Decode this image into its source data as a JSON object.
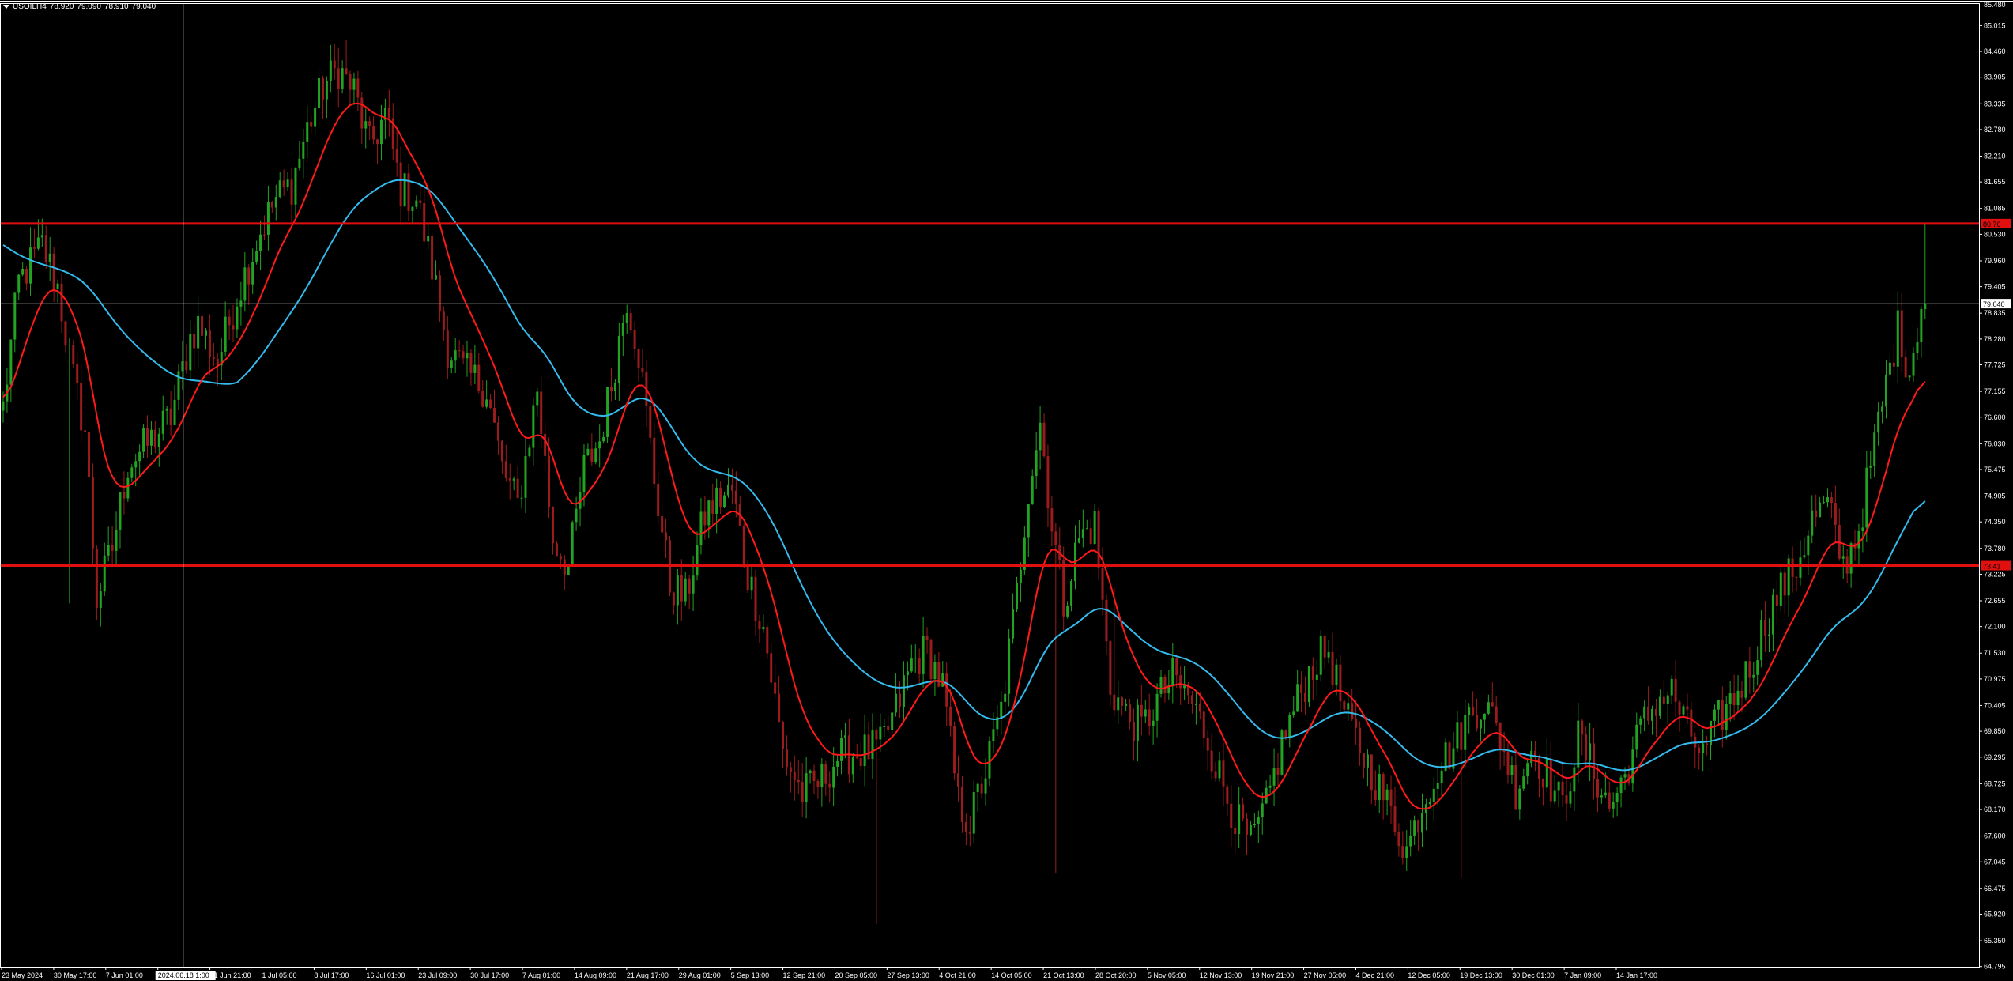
{
  "header": {
    "symbol": "USOILH4",
    "ohlc": [
      "78.920",
      "79.090",
      "78.910",
      "79.040"
    ]
  },
  "colors": {
    "background": "#000000",
    "bull_candle": "#22a322",
    "bear_candle": "#9b1c1c",
    "ma_fast": "#ff1a1a",
    "ma_slow": "#33bbee",
    "hline": "#e01010",
    "axis_text": "#ffffff",
    "grid_line": "#888888"
  },
  "chart_data": {
    "type": "candlestick",
    "ylim": [
      64.79,
      85.48
    ],
    "y_ticks": [
      "85.015",
      "84.460",
      "83.905",
      "83.335",
      "82.780",
      "82.210",
      "81.655",
      "81.085",
      "80.530",
      "79.960",
      "79.405",
      "78.835",
      "78.280",
      "77.725",
      "77.155",
      "76.600",
      "76.030",
      "75.475",
      "74.905",
      "74.350",
      "73.780",
      "73.225",
      "72.655",
      "72.100",
      "71.530",
      "70.975",
      "70.405",
      "69.850",
      "69.295",
      "68.725",
      "68.170",
      "67.600",
      "67.045",
      "66.475",
      "65.920",
      "65.350",
      "64.795"
    ],
    "top_tick": "85.480",
    "x_labels": [
      "23 May 2024",
      "30 May 17:00",
      "7 Jun 01:00",
      "2024.06.18 1:00",
      "21 Jun 21:00",
      "1 Jul 05:00",
      "8 Jul 17:00",
      "16 Jul 01:00",
      "23 Jul 09:00",
      "30 Jul 17:00",
      "7 Aug 01:00",
      "14 Aug 09:00",
      "21 Aug 17:00",
      "29 Aug 01:00",
      "5 Sep 13:00",
      "12 Sep 21:00",
      "20 Sep 05:00",
      "27 Sep 13:00",
      "4 Oct 21:00",
      "14 Oct 05:00",
      "21 Oct 13:00",
      "28 Oct 20:00",
      "5 Nov 05:00",
      "12 Nov 13:00",
      "19 Nov 21:00",
      "27 Nov 05:00",
      "4 Dec 21:00",
      "12 Dec 05:00",
      "19 Dec 13:00",
      "30 Dec 01:00",
      "7 Jan 09:00",
      "14 Jan 17:00"
    ],
    "crosshair_label_index": 3,
    "hlines": [
      {
        "price": 80.76,
        "label": "80.76"
      },
      {
        "price": 73.41,
        "label": "73.41"
      }
    ],
    "current_price": {
      "price": 79.04,
      "label": "79.040"
    },
    "price_anchors": [
      [
        0,
        76.8
      ],
      [
        4,
        79.5
      ],
      [
        10,
        80.3
      ],
      [
        14,
        79.4
      ],
      [
        18,
        77.4
      ],
      [
        21,
        76.3
      ],
      [
        24,
        72.7
      ],
      [
        28,
        73.8
      ],
      [
        32,
        75.6
      ],
      [
        38,
        76.1
      ],
      [
        43,
        76.6
      ],
      [
        48,
        78.3
      ],
      [
        50,
        78.6
      ],
      [
        55,
        77.8
      ],
      [
        60,
        79.2
      ],
      [
        66,
        80.6
      ],
      [
        70,
        81.3
      ],
      [
        74,
        81.6
      ],
      [
        78,
        82.8
      ],
      [
        82,
        83.7
      ],
      [
        86,
        84.1
      ],
      [
        90,
        83.6
      ],
      [
        94,
        82.4
      ],
      [
        98,
        83.1
      ],
      [
        102,
        81.5
      ],
      [
        106,
        81.3
      ],
      [
        110,
        79.8
      ],
      [
        114,
        78.1
      ],
      [
        118,
        77.6
      ],
      [
        124,
        77.2
      ],
      [
        128,
        75.5
      ],
      [
        132,
        74.7
      ],
      [
        137,
        77.2
      ],
      [
        141,
        74.0
      ],
      [
        145,
        73.4
      ],
      [
        149,
        75.5
      ],
      [
        153,
        76.1
      ],
      [
        156,
        77.3
      ],
      [
        160,
        79.2
      ],
      [
        163,
        78.0
      ],
      [
        167,
        75.3
      ],
      [
        171,
        73.0
      ],
      [
        175,
        72.7
      ],
      [
        180,
        74.5
      ],
      [
        183,
        74.8
      ],
      [
        187,
        75.0
      ],
      [
        191,
        73.2
      ],
      [
        195,
        72.1
      ],
      [
        200,
        69.4
      ],
      [
        205,
        68.5
      ],
      [
        210,
        68.8
      ],
      [
        214,
        69.3
      ],
      [
        220,
        69.4
      ],
      [
        225,
        69.5
      ],
      [
        229,
        70.3
      ],
      [
        233,
        71.3
      ],
      [
        237,
        71.6
      ],
      [
        241,
        70.8
      ],
      [
        245,
        68.3
      ],
      [
        248,
        67.9
      ],
      [
        252,
        69.0
      ],
      [
        256,
        70.3
      ],
      [
        260,
        72.8
      ],
      [
        263,
        75.1
      ],
      [
        266,
        76.5
      ],
      [
        269,
        74.3
      ],
      [
        272,
        72.6
      ],
      [
        276,
        74.0
      ],
      [
        280,
        74.3
      ],
      [
        284,
        70.8
      ],
      [
        288,
        70.2
      ],
      [
        292,
        69.9
      ],
      [
        296,
        70.5
      ],
      [
        300,
        71.0
      ],
      [
        304,
        70.6
      ],
      [
        308,
        69.9
      ],
      [
        312,
        68.9
      ],
      [
        316,
        68.0
      ],
      [
        320,
        67.4
      ],
      [
        324,
        68.2
      ],
      [
        328,
        69.6
      ],
      [
        332,
        70.5
      ],
      [
        336,
        71.3
      ],
      [
        340,
        71.6
      ],
      [
        344,
        70.2
      ],
      [
        348,
        69.5
      ],
      [
        352,
        68.8
      ],
      [
        356,
        68.1
      ],
      [
        360,
        67.3
      ],
      [
        364,
        68.3
      ],
      [
        368,
        69.1
      ],
      [
        372,
        69.5
      ],
      [
        376,
        70.2
      ],
      [
        380,
        70.5
      ],
      [
        384,
        69.7
      ],
      [
        388,
        68.6
      ],
      [
        392,
        69.5
      ],
      [
        396,
        68.9
      ],
      [
        400,
        68.2
      ],
      [
        404,
        69.7
      ],
      [
        408,
        69.0
      ],
      [
        412,
        68.2
      ],
      [
        416,
        68.9
      ],
      [
        420,
        69.9
      ],
      [
        424,
        70.5
      ],
      [
        428,
        70.7
      ],
      [
        432,
        69.9
      ],
      [
        436,
        69.3
      ],
      [
        440,
        70.1
      ],
      [
        444,
        70.6
      ],
      [
        448,
        71.2
      ],
      [
        452,
        72.2
      ],
      [
        456,
        72.9
      ],
      [
        460,
        73.4
      ],
      [
        464,
        74.4
      ],
      [
        468,
        74.7
      ],
      [
        472,
        73.4
      ],
      [
        476,
        74.2
      ],
      [
        480,
        76.0
      ],
      [
        483,
        77.3
      ],
      [
        486,
        78.5
      ],
      [
        489,
        77.6
      ],
      [
        492,
        79.04
      ]
    ],
    "extremes": [
      [
        17,
        72.6
      ],
      [
        88,
        84.7
      ],
      [
        224,
        65.7
      ],
      [
        270,
        66.8
      ],
      [
        285,
        72.95
      ],
      [
        374,
        66.7
      ],
      [
        493,
        80.76
      ]
    ],
    "n_candles": 494
  }
}
